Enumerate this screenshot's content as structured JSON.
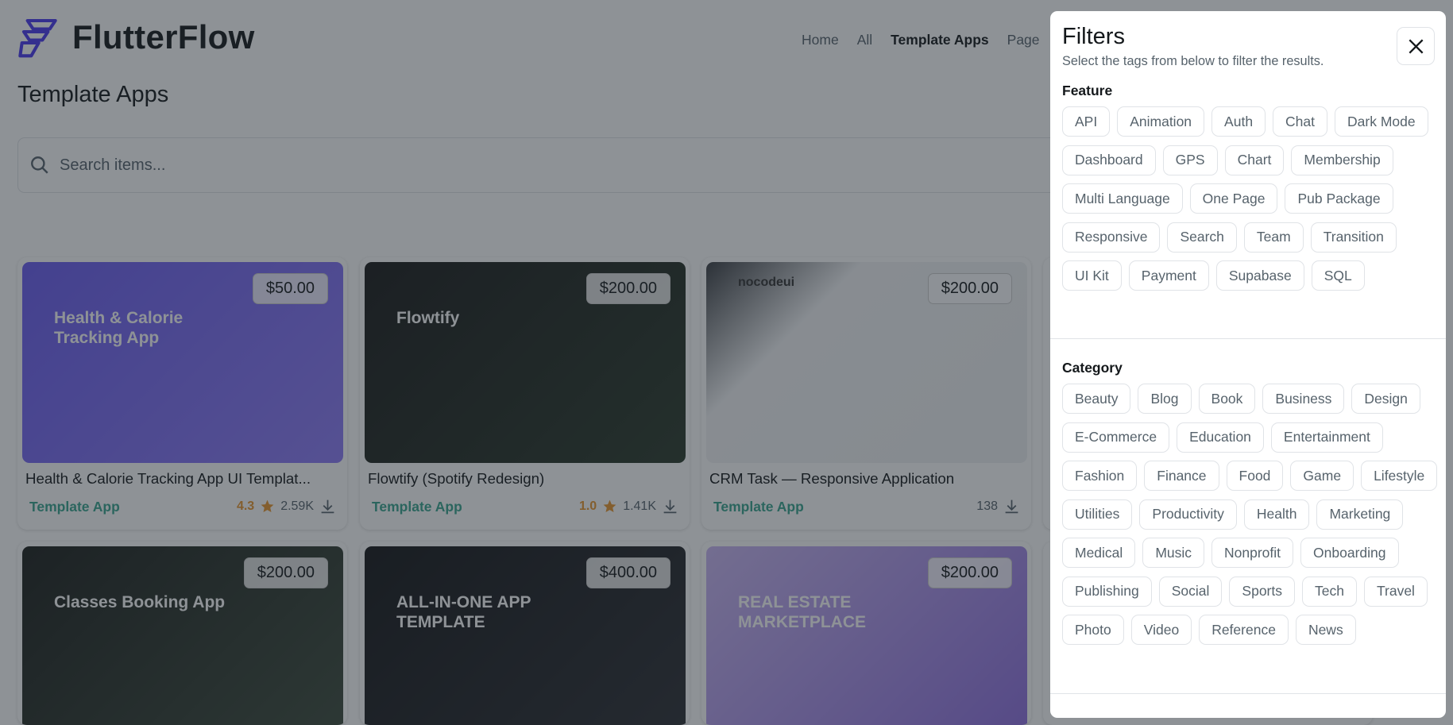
{
  "header": {
    "logo_text": "FlutterFlow",
    "nav": [
      "Home",
      "All",
      "Template Apps",
      "Page"
    ],
    "active_nav": "Template Apps"
  },
  "page_title": "Template Apps",
  "search": {
    "placeholder": "Search items...",
    "value": ""
  },
  "cards": [
    {
      "name": "Health & Calorie Tracking App UI Templat...",
      "price": "$50.00",
      "type": "Template App",
      "rating": "4.3",
      "downloads": "2.59K",
      "image_text": "Health & Calorie Tracking App",
      "bg": "linear-gradient(135deg,#6a5cf0,#8e7cf6)"
    },
    {
      "name": "Flowtify (Spotify Redesign)",
      "price": "$200.00",
      "type": "Template App",
      "rating": "1.0",
      "downloads": "1.41K",
      "image_text": "Flowtify",
      "bg": "linear-gradient(135deg,#1a1a1a,#2b3a2b)"
    },
    {
      "name": "CRM Task — Responsive Application",
      "price": "$200.00",
      "type": "Template App",
      "rating": null,
      "downloads": "138",
      "image_text": "nocodeui",
      "bg": "linear-gradient(135deg,#3a3d42,#f2f3f5 30%,#eef0f2)"
    },
    {
      "name": "",
      "price": "$200.00",
      "type": "",
      "rating": null,
      "downloads": "",
      "image_text": "Classes Booking App",
      "bg": "linear-gradient(135deg,#1c1f1c,#3c4a3c)"
    },
    {
      "name": "",
      "price": "$400.00",
      "type": "",
      "rating": null,
      "downloads": "",
      "image_text": "ALL-IN-ONE APP TEMPLATE",
      "bg": "linear-gradient(135deg,#151618,#2c2e33)"
    },
    {
      "name": "",
      "price": "$200.00",
      "type": "",
      "rating": null,
      "downloads": "",
      "image_text": "REAL ESTATE MARKETPLACE",
      "bg": "linear-gradient(135deg,#c9b6f2,#8f6fe0)"
    }
  ],
  "filters": {
    "title": "Filters",
    "subtitle": "Select the tags from below to filter the results.",
    "feature_label": "Feature",
    "feature_tags": [
      "API",
      "Animation",
      "Auth",
      "Chat",
      "Dark Mode",
      "Dashboard",
      "GPS",
      "Chart",
      "Membership",
      "Multi Language",
      "One Page",
      "Pub Package",
      "Responsive",
      "Search",
      "Team",
      "Transition",
      "UI Kit",
      "Payment",
      "Supabase",
      "SQL"
    ],
    "category_label": "Category",
    "category_tags": [
      "Beauty",
      "Blog",
      "Book",
      "Business",
      "Design",
      "E-Commerce",
      "Education",
      "Entertainment",
      "Fashion",
      "Finance",
      "Food",
      "Game",
      "Lifestyle",
      "Utilities",
      "Productivity",
      "Health",
      "Marketing",
      "Medical",
      "Music",
      "Nonprofit",
      "Onboarding",
      "Publishing",
      "Social",
      "Sports",
      "Tech",
      "Travel",
      "Photo",
      "Video",
      "Reference",
      "News"
    ]
  },
  "colors": {
    "accent": "#39a58f",
    "rating": "#e8962e",
    "logo": "#4b39ef"
  }
}
